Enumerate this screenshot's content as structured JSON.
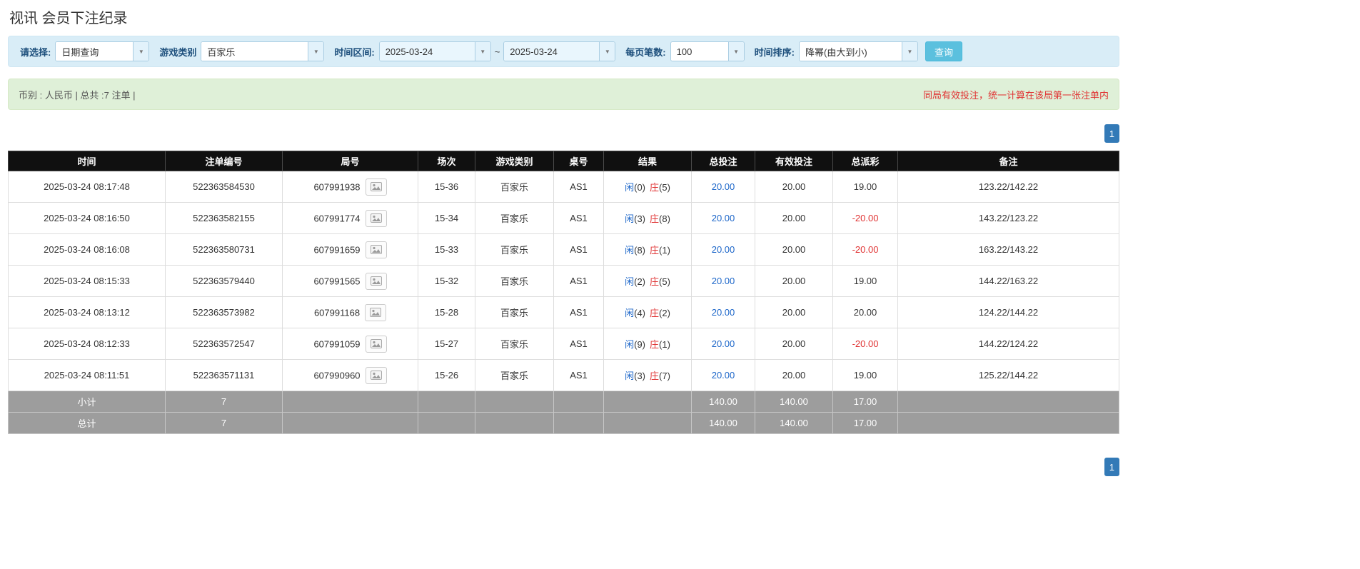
{
  "page": {
    "title": "视讯 会员下注纪录"
  },
  "icons": {
    "chevron_down": "▼"
  },
  "colors": {
    "filter_bg": "#d9edf7",
    "summary_bg": "#dff0d8",
    "header_bg": "#101010",
    "footer_bg": "#9d9d9d",
    "accent_blue": "#337ab7",
    "link_blue": "#1c66c9",
    "negative_red": "#e03333",
    "search_button_bg": "#5bc0de"
  },
  "filters": {
    "select_label": "请选择:",
    "select_value": "日期查询",
    "game_type_label": "游戏类别",
    "game_type_value": "百家乐",
    "date_range_label": "时间区间:",
    "date_from": "2025-03-24",
    "tilde": "~",
    "date_to": "2025-03-24",
    "per_page_label": "每页笔数:",
    "per_page_value": "100",
    "sort_label": "时间排序:",
    "sort_value": "降幂(由大到小)",
    "search_button": "查询"
  },
  "summary": {
    "left": "币别 : 人民币 | 总共 :7 注单 |",
    "right": "同局有效投注，统一计算在该局第一张注单内"
  },
  "pagination": {
    "page": "1"
  },
  "table": {
    "headers": [
      "时间",
      "注单编号",
      "局号",
      "场次",
      "游戏类别",
      "桌号",
      "结果",
      "总投注",
      "有效投注",
      "总派彩",
      "备注"
    ],
    "rows": [
      {
        "time": "2025-03-24 08:17:48",
        "bet_id": "522363584530",
        "round_id": "607991938",
        "session": "15-36",
        "game": "百家乐",
        "table_no": "AS1",
        "player": "闲",
        "player_n": "(0)",
        "banker": "庄",
        "banker_n": "(5)",
        "total_bet": "20.00",
        "valid_bet": "20.00",
        "payout": "19.00",
        "remark": "123.22/142.22"
      },
      {
        "time": "2025-03-24 08:16:50",
        "bet_id": "522363582155",
        "round_id": "607991774",
        "session": "15-34",
        "game": "百家乐",
        "table_no": "AS1",
        "player": "闲",
        "player_n": "(3)",
        "banker": "庄",
        "banker_n": "(8)",
        "total_bet": "20.00",
        "valid_bet": "20.00",
        "payout": "-20.00",
        "remark": "143.22/123.22"
      },
      {
        "time": "2025-03-24 08:16:08",
        "bet_id": "522363580731",
        "round_id": "607991659",
        "session": "15-33",
        "game": "百家乐",
        "table_no": "AS1",
        "player": "闲",
        "player_n": "(8)",
        "banker": "庄",
        "banker_n": "(1)",
        "total_bet": "20.00",
        "valid_bet": "20.00",
        "payout": "-20.00",
        "remark": "163.22/143.22"
      },
      {
        "time": "2025-03-24 08:15:33",
        "bet_id": "522363579440",
        "round_id": "607991565",
        "session": "15-32",
        "game": "百家乐",
        "table_no": "AS1",
        "player": "闲",
        "player_n": "(2)",
        "banker": "庄",
        "banker_n": "(5)",
        "total_bet": "20.00",
        "valid_bet": "20.00",
        "payout": "19.00",
        "remark": "144.22/163.22"
      },
      {
        "time": "2025-03-24 08:13:12",
        "bet_id": "522363573982",
        "round_id": "607991168",
        "session": "15-28",
        "game": "百家乐",
        "table_no": "AS1",
        "player": "闲",
        "player_n": "(4)",
        "banker": "庄",
        "banker_n": "(2)",
        "total_bet": "20.00",
        "valid_bet": "20.00",
        "payout": "20.00",
        "remark": "124.22/144.22"
      },
      {
        "time": "2025-03-24 08:12:33",
        "bet_id": "522363572547",
        "round_id": "607991059",
        "session": "15-27",
        "game": "百家乐",
        "table_no": "AS1",
        "player": "闲",
        "player_n": "(9)",
        "banker": "庄",
        "banker_n": "(1)",
        "total_bet": "20.00",
        "valid_bet": "20.00",
        "payout": "-20.00",
        "remark": "144.22/124.22"
      },
      {
        "time": "2025-03-24 08:11:51",
        "bet_id": "522363571131",
        "round_id": "607990960",
        "session": "15-26",
        "game": "百家乐",
        "table_no": "AS1",
        "player": "闲",
        "player_n": "(3)",
        "banker": "庄",
        "banker_n": "(7)",
        "total_bet": "20.00",
        "valid_bet": "20.00",
        "payout": "19.00",
        "remark": "125.22/144.22"
      }
    ],
    "subtotal": {
      "label": "小计",
      "count": "7",
      "total_bet": "140.00",
      "valid_bet": "140.00",
      "payout": "17.00"
    },
    "total": {
      "label": "总计",
      "count": "7",
      "total_bet": "140.00",
      "valid_bet": "140.00",
      "payout": "17.00"
    }
  }
}
